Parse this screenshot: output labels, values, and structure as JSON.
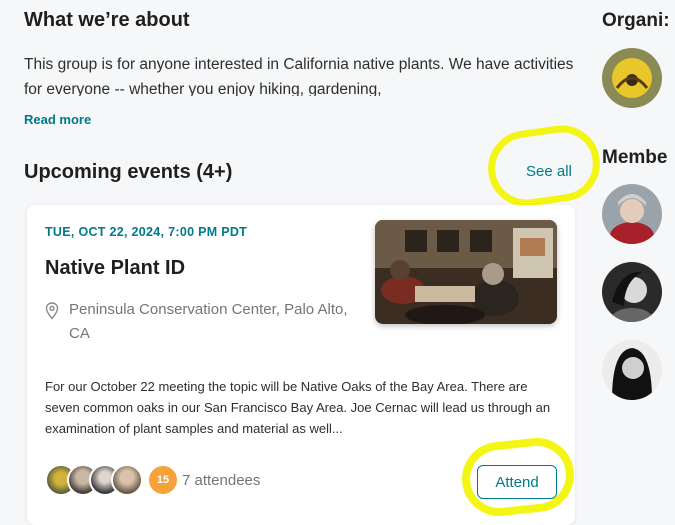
{
  "about": {
    "title": "What we’re about",
    "description": "This group is for anyone interested in California native plants. We have activities for everyone -- whether you enjoy hiking, gardening,",
    "read_more": "Read more"
  },
  "events": {
    "title": "Upcoming events (4+)",
    "see_all": "See all",
    "event": {
      "date": "TUE, OCT 22, 2024, 7:00 PM PDT",
      "title": "Native Plant ID",
      "location": "Peninsula Conservation Center, Palo Alto, CA",
      "description": "For our October 22 meeting the topic will be Native Oaks of the Bay Area. There are seven common oaks in our San Francisco Bay Area. Joe Cernac will lead us through an examination of plant samples and material as well...",
      "attendee_more": "15",
      "attendee_count": "7 attendees",
      "attend_label": "Attend"
    }
  },
  "sidebar": {
    "organizer_heading": "Organi:",
    "members_heading": "Membe"
  },
  "colors": {
    "accent": "#00798a",
    "highlight": "#f3f515"
  }
}
